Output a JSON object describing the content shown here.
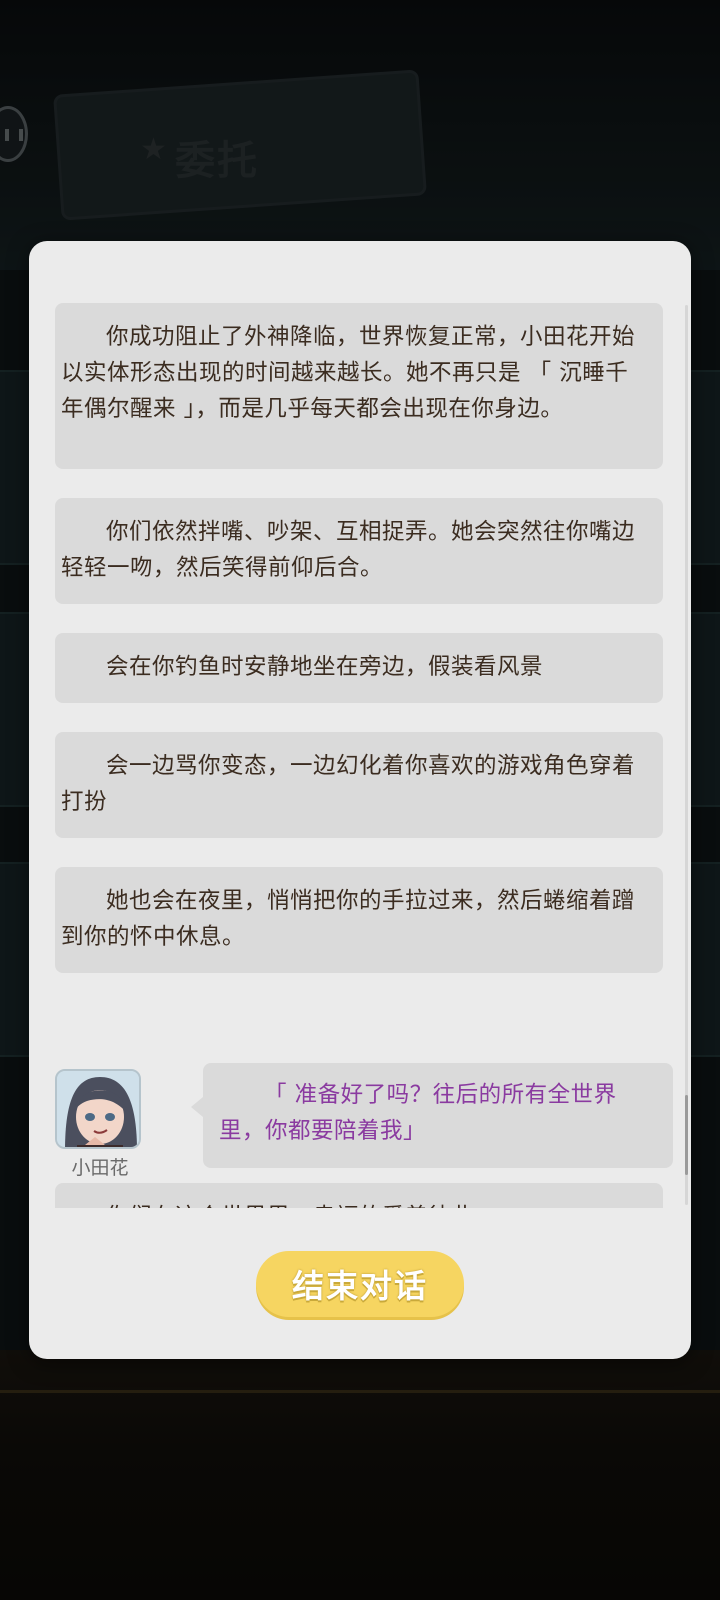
{
  "background": {
    "banner_text": "委托"
  },
  "dialog": {
    "narrations": [
      "你成功阻止了外神降临，世界恢复正常，小田花开始以实体形态出现的时间越来越长。她不再只是 「 沉睡千年偶尔醒来 」，而是几乎每天都会出现在你身边。",
      "你们依然拌嘴、吵架、互相捉弄。她会突然往你嘴边轻轻一吻，然后笑得前仰后合。",
      "会在你钓鱼时安静地坐在旁边，假装看风景",
      "会一边骂你变态，一边幻化着你喜欢的游戏角色穿着打扮",
      "她也会在夜里，悄悄把你的手拉过来，然后蜷缩着蹭到你的怀中休息。"
    ],
    "speaker": {
      "name": "小田花",
      "line": "「 准备好了吗？往后的所有全世界里，你都要陪着我」"
    },
    "final_narration": "你们在这个世界里，幸福的爱着彼此。",
    "end_button_label": "结束对话"
  },
  "colors": {
    "narration_text": "#3b2c20",
    "speaker_quote": "#8a3aa0",
    "button": "#f6d561",
    "dialog_bg": "#ebebeb",
    "bubble_bg": "#dadada"
  }
}
